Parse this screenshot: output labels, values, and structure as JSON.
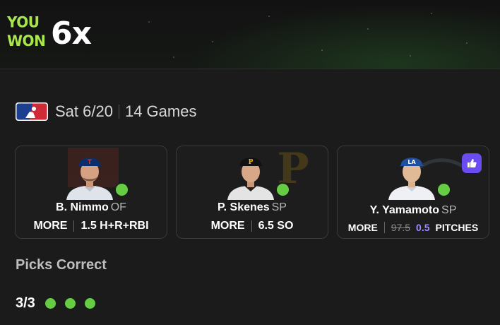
{
  "banner": {
    "you_won_line1": "YOU",
    "you_won_line2": "WON",
    "multiplier": "6x"
  },
  "slate": {
    "league_logo": "mlb-logo",
    "date": "Sat 6/20",
    "games": "14 Games"
  },
  "picks": [
    {
      "player": "B. Nimmo",
      "position": "OF",
      "direction": "MORE",
      "line": "1.5",
      "stat": "H+R+RBI",
      "team_color": "#0b2d6b",
      "status": "correct"
    },
    {
      "player": "P. Skenes",
      "position": "SP",
      "direction": "MORE",
      "line": "6.5",
      "stat": "SO",
      "team_color": "#111111",
      "status": "correct"
    },
    {
      "player": "Y. Yamamoto",
      "position": "SP",
      "direction": "MORE",
      "original_line": "97.5",
      "line": "0.5",
      "stat": "PITCHES",
      "team_color": "#1e4fa0",
      "status": "correct",
      "badge_icon": "thumbs-up-icon"
    }
  ],
  "summary": {
    "title": "Picks Correct",
    "count": "3/3",
    "correct_color": "#66cc44"
  },
  "colors": {
    "accent_green": "#a8e64b",
    "status_green": "#66cc44",
    "boost_purple": "#9f8cff",
    "badge_purple": "#6b4cf0"
  }
}
